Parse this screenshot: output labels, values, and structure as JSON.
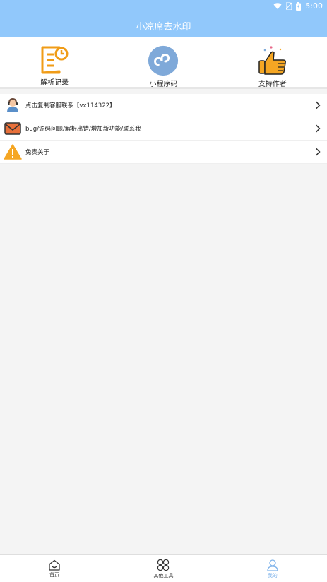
{
  "status_bar": {
    "time": "5:00"
  },
  "app_bar": {
    "title": "小凉席去水印"
  },
  "shortcuts": [
    {
      "label": "解析记录",
      "icon": "history-record-icon"
    },
    {
      "label": "小程序码",
      "icon": "mini-program-icon"
    },
    {
      "label": "支持作者",
      "icon": "thumbs-up-icon"
    }
  ],
  "menu": [
    {
      "text": "点击复制客服联系【vx114322】",
      "icon": "customer-service-icon"
    },
    {
      "text": "bug/源码问题/解析出错/增加新功能/联系我",
      "icon": "mail-icon"
    },
    {
      "text": "免责关于",
      "icon": "warning-icon"
    }
  ],
  "tab_bar": {
    "items": [
      {
        "label": "首页",
        "icon": "home-icon"
      },
      {
        "label": "其他工具",
        "icon": "tools-icon"
      },
      {
        "label": "我的",
        "icon": "profile-icon"
      }
    ],
    "active_index": 2,
    "active_color": "#7fb3ea"
  },
  "colors": {
    "header": "#91c8fb",
    "accent_orange": "#f5a623"
  }
}
